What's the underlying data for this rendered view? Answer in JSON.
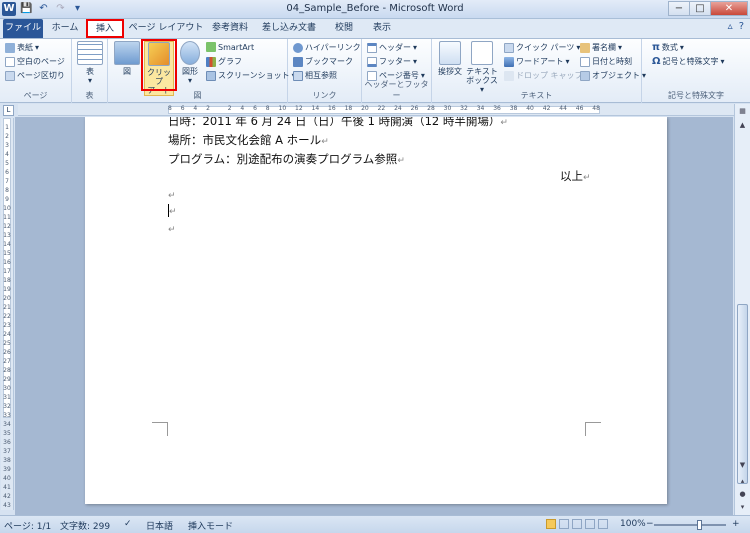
{
  "window": {
    "title": "04_Sample_Before - Microsoft Word",
    "app_icon_letter": "W",
    "controls": {
      "minimize": "−",
      "maximize": "□",
      "close": "✕"
    }
  },
  "tabs": [
    {
      "label": "ファイル"
    },
    {
      "label": "ホーム"
    },
    {
      "label": "挿入"
    },
    {
      "label": "ページ レイアウト"
    },
    {
      "label": "参考資料"
    },
    {
      "label": "差し込み文書"
    },
    {
      "label": "校閲"
    },
    {
      "label": "表示"
    }
  ],
  "ribbon": {
    "groups": {
      "page": {
        "label": "ページ",
        "items": [
          "表紙",
          "空白のページ",
          "ページ区切り"
        ]
      },
      "table": {
        "label": "表",
        "button": "表"
      },
      "illust": {
        "label": "図",
        "buttons": [
          "図",
          "クリップ",
          "アート",
          "図形"
        ],
        "items": [
          "SmartArt",
          "グラフ",
          "スクリーンショット"
        ]
      },
      "link": {
        "label": "リンク",
        "items": [
          "ハイパーリンク",
          "ブックマーク",
          "相互参照"
        ]
      },
      "headfoot": {
        "label": "ヘッダーとフッター",
        "items": [
          "ヘッダー",
          "フッター",
          "ページ番号"
        ]
      },
      "text": {
        "label": "テキスト",
        "buttons": [
          "挨拶文",
          "テキスト",
          "ボックス"
        ],
        "items": [
          "クイック パーツ",
          "ワードアート",
          "ドロップ キャップ",
          "署名欄",
          "日付と時刻",
          "オブジェクト"
        ]
      },
      "symbol": {
        "label": "記号と特殊文字",
        "items": [
          "数式",
          "記号と特殊文字"
        ]
      }
    }
  },
  "document": {
    "lines": [
      "日時：2011 年 6 月 24 日（日）午後 1 時開演（12 時半開場）",
      "場所：市民文化会館 A ホール",
      "プログラム：別途配布の演奏プログラム参照",
      "以上"
    ],
    "paragraph_mark": "↵"
  },
  "ruler": {
    "h_numbers": [
      "8",
      "6",
      "4",
      "2",
      "",
      "2",
      "4",
      "6",
      "8",
      "10",
      "12",
      "14",
      "16",
      "18",
      "20",
      "22",
      "24",
      "26",
      "28",
      "30",
      "32",
      "34",
      "36",
      "38",
      "40",
      "42",
      "44",
      "46",
      "48"
    ],
    "v_numbers": [
      "1",
      "2",
      "3",
      "4",
      "5",
      "6",
      "7",
      "8",
      "9",
      "10",
      "11",
      "12",
      "13",
      "14",
      "15",
      "16",
      "17",
      "18",
      "19",
      "20",
      "21",
      "22",
      "23",
      "24",
      "25",
      "26",
      "27",
      "28",
      "29",
      "30",
      "31",
      "32",
      "33",
      "34",
      "35",
      "36",
      "37",
      "38",
      "39",
      "40",
      "41",
      "42",
      "43"
    ]
  },
  "status": {
    "page": "ページ: 1/1",
    "chars": "文字数: 299",
    "lang": "日本語",
    "mode": "挿入モード",
    "zoom": "100%",
    "zoom_fraction": 0.62
  }
}
